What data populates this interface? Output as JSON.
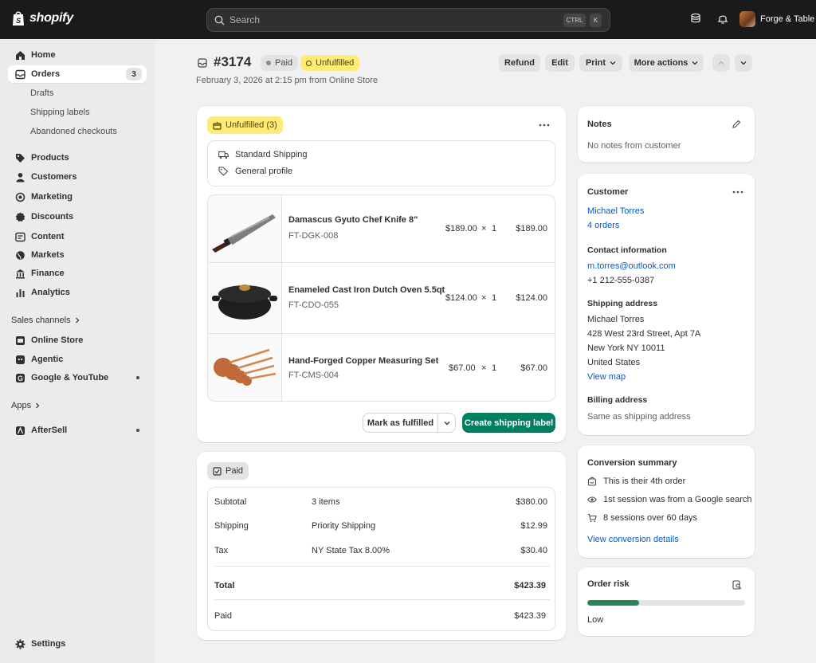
{
  "topbar": {
    "logo_text": "shopify",
    "search_placeholder": "Search",
    "shortcut_ctrl": "CTRL",
    "shortcut_key": "K",
    "store_name": "Forge & Table"
  },
  "sidebar": {
    "items": [
      {
        "label": "Home",
        "icon": "home-icon"
      },
      {
        "label": "Orders",
        "icon": "orders-icon",
        "badge": "3"
      },
      {
        "label": "Drafts"
      },
      {
        "label": "Shipping labels"
      },
      {
        "label": "Abandoned checkouts"
      },
      {
        "label": "Products",
        "icon": "tag-icon"
      },
      {
        "label": "Customers",
        "icon": "person-icon"
      },
      {
        "label": "Marketing",
        "icon": "target-icon"
      },
      {
        "label": "Discounts",
        "icon": "discount-icon"
      },
      {
        "label": "Content",
        "icon": "content-icon"
      },
      {
        "label": "Markets",
        "icon": "globe-icon"
      },
      {
        "label": "Finance",
        "icon": "bank-icon"
      },
      {
        "label": "Analytics",
        "icon": "chart-bar-icon"
      }
    ],
    "sales_channels_label": "Sales channels",
    "channels": [
      {
        "label": "Online Store",
        "icon": "store-icon"
      },
      {
        "label": "Agentic",
        "icon": "agentic-icon"
      },
      {
        "label": "Google & YouTube",
        "icon": "google-icon"
      }
    ],
    "apps_label": "Apps",
    "apps": [
      {
        "label": "AfterSell",
        "icon": "aftersell-icon"
      }
    ],
    "settings_label": "Settings"
  },
  "header": {
    "order_number": "#3174",
    "payment_status": "Paid",
    "fulfillment_status": "Unfulfilled",
    "date_line": "February 3, 2026 at 2:15 pm from Online Store",
    "actions": {
      "refund": "Refund",
      "edit": "Edit",
      "print": "Print",
      "more": "More actions"
    }
  },
  "fulfillment": {
    "badge": "Unfulfilled (3)",
    "shipping_method": "Standard Shipping",
    "profile": "General profile",
    "items": [
      {
        "name": "Damascus Gyuto Chef Knife 8\"",
        "sku": "FT-DGK-008",
        "price": "$189.00",
        "times": "×",
        "qty": "1",
        "total": "$189.00"
      },
      {
        "name": "Enameled Cast Iron Dutch Oven 5.5qt",
        "sku": "FT-CDO-055",
        "price": "$124.00",
        "times": "×",
        "qty": "1",
        "total": "$124.00"
      },
      {
        "name": "Hand-Forged Copper Measuring Set",
        "sku": "FT-CMS-004",
        "price": "$67.00",
        "times": "×",
        "qty": "1",
        "total": "$67.00"
      }
    ],
    "mark_fulfilled": "Mark as fulfilled",
    "create_label": "Create shipping label"
  },
  "payment": {
    "badge": "Paid",
    "lines": [
      {
        "label": "Subtotal",
        "desc": "3 items",
        "amount": "$380.00"
      },
      {
        "label": "Shipping",
        "desc": "Priority Shipping",
        "amount": "$12.99"
      },
      {
        "label": "Tax",
        "desc": "NY State Tax 8.00%",
        "amount": "$30.40"
      }
    ],
    "total_label": "Total",
    "total_amount": "$423.39",
    "paid_label": "Paid",
    "paid_amount": "$423.39"
  },
  "notes": {
    "title": "Notes",
    "text": "No notes from customer"
  },
  "customer": {
    "title": "Customer",
    "name": "Michael Torres",
    "orders": "4 orders",
    "contact_title": "Contact information",
    "email": "m.torres@outlook.com",
    "phone": "+1 212-555-0387",
    "shipping_title": "Shipping address",
    "address": [
      "Michael Torres",
      "428 West 23rd Street, Apt 7A",
      "New York NY 10011",
      "United States"
    ],
    "view_map": "View map",
    "billing_title": "Billing address",
    "billing_text": "Same as shipping address"
  },
  "conversion": {
    "title": "Conversion summary",
    "lines": [
      "This is their 4th order",
      "1st session was from a Google search",
      "8 sessions over 60 days"
    ],
    "link": "View conversion details"
  },
  "risk": {
    "title": "Order risk",
    "level": "Low",
    "fill_fraction": 0.33,
    "color": "#29845a"
  },
  "colors": {
    "accent_green": "#008060",
    "unfulfilled_yellow": "#ffeb78",
    "link_blue": "#005bd3"
  }
}
